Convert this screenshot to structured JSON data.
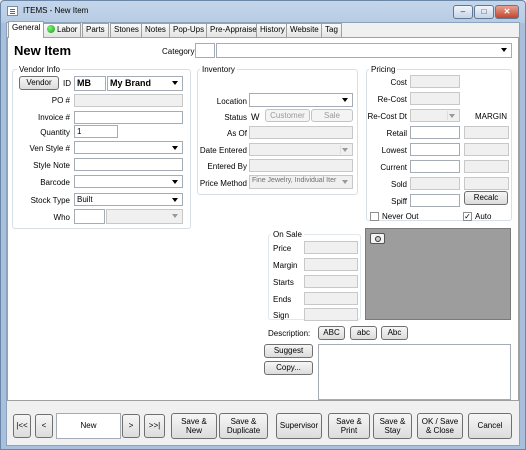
{
  "window": {
    "title": "ITEMS - New Item",
    "minimize": "–",
    "maximize": "□",
    "close": "✕"
  },
  "tabs": [
    "General",
    "Labor",
    "Parts",
    "Stones",
    "Notes",
    "Pop-Ups",
    "Pre-Appraise",
    "History",
    "Website",
    "Tag"
  ],
  "header": {
    "title": "New Item",
    "category_label": "Category",
    "category_value": ""
  },
  "vendor_info": {
    "group_title": "Vendor Info",
    "vendor_button": "Vendor",
    "id_label": "ID",
    "id_value": "MB",
    "vendor_name": "My Brand",
    "po_label": "PO #",
    "po_value": "",
    "invoice_label": "Invoice #",
    "invoice_value": "",
    "quantity_label": "Quantity",
    "quantity_value": "1",
    "ven_style_label": "Ven Style #",
    "ven_style_value": "",
    "style_note_label": "Style Note",
    "style_note_value": "",
    "barcode_label": "Barcode",
    "barcode_value": "",
    "stock_type_label": "Stock Type",
    "stock_type_value": "Built",
    "who_label": "Who",
    "who_value": ""
  },
  "inventory": {
    "group_title": "Inventory",
    "location_label": "Location",
    "location_value": "",
    "status_label": "Status",
    "status_value": "W",
    "customer_button": "Customer",
    "sale_button": "Sale",
    "as_of_label": "As Of",
    "date_entered_label": "Date Entered",
    "entered_by_label": "Entered By",
    "price_method_label": "Price Method",
    "price_method_value": "Fine Jewelry, Individual Iter"
  },
  "pricing": {
    "group_title": "Pricing",
    "cost_label": "Cost",
    "recost_label": "Re-Cost",
    "recost_dt_label": "Re-Cost Dt",
    "margin_label": "MARGIN",
    "retail_label": "Retail",
    "lowest_label": "Lowest",
    "current_label": "Current",
    "sold_label": "Sold",
    "spiff_label": "Spiff",
    "recalc_button": "Recalc",
    "never_out_label": "Never Out",
    "never_out_checked": false,
    "auto_label": "Auto",
    "auto_checked": true
  },
  "on_sale": {
    "title": "On Sale",
    "price_label": "Price",
    "margin_label": "Margin",
    "starts_label": "Starts",
    "ends_label": "Ends",
    "sign_label": "Sign"
  },
  "description": {
    "label": "Description:",
    "btn_upper": "ABC",
    "btn_lower": "abc",
    "btn_title": "Abc",
    "suggest_button": "Suggest",
    "copy_button": "Copy...",
    "value": ""
  },
  "navigation": {
    "first": "|<<",
    "prev": "<",
    "page": "New",
    "next": ">",
    "last": ">>|"
  },
  "actions": {
    "save_new": "Save &\nNew",
    "save_duplicate": "Save &\nDuplicate",
    "supervisor": "Supervisor",
    "save_print": "Save &\nPrint",
    "save_stay": "Save &\nStay",
    "ok_save_close": "OK / Save\n& Close",
    "cancel": "Cancel"
  },
  "icons": {
    "camera": "camera-icon",
    "labor_status": "green-dot-icon"
  }
}
